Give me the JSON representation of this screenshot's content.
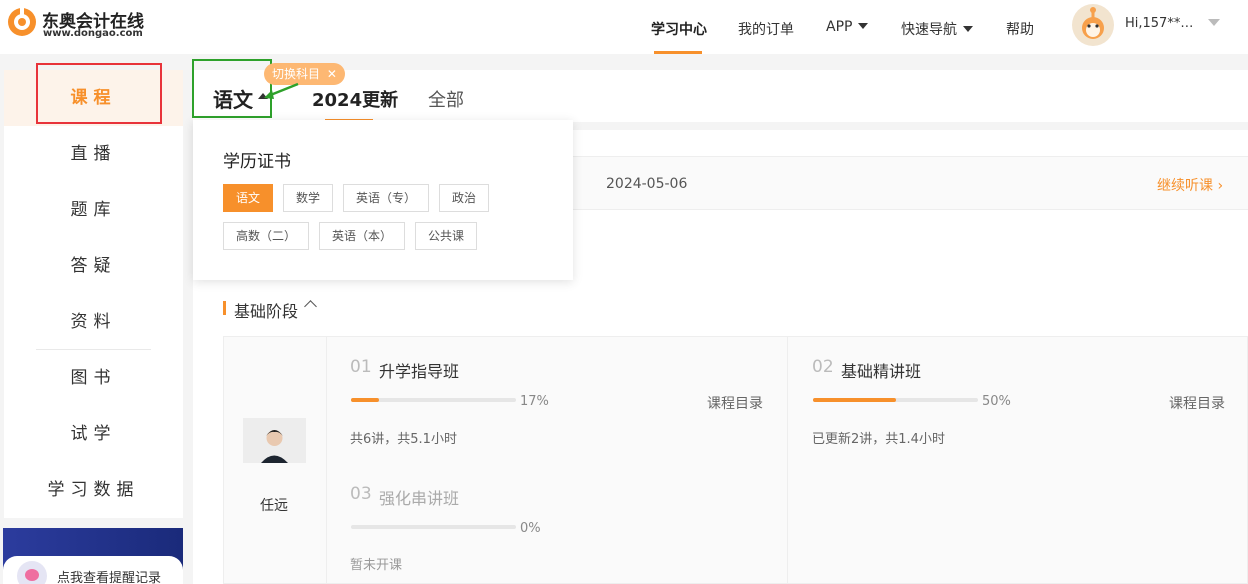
{
  "header": {
    "logo_title": "东奥会计在线",
    "logo_url": "www.dongao.com",
    "nav": [
      {
        "label": "学习中心",
        "active": true
      },
      {
        "label": "我的订单"
      },
      {
        "label": "APP",
        "dropdown": true
      },
      {
        "label": "快速导航",
        "dropdown": true
      },
      {
        "label": "帮助"
      }
    ],
    "user_name": "Hi,157**…"
  },
  "sidebar": {
    "items": [
      {
        "label": "课程",
        "active": true
      },
      {
        "label": "直播"
      },
      {
        "label": "题库"
      },
      {
        "label": "答疑"
      },
      {
        "label": "资料"
      },
      {
        "label": "图书"
      },
      {
        "label": "试学"
      },
      {
        "label": "学习数据"
      }
    ],
    "reminder": "点我查看提醒记录"
  },
  "subject": {
    "current": "语文",
    "switch_tip": "切换科目",
    "tabs": [
      "2024更新",
      "全部"
    ]
  },
  "dropdown": {
    "title": "学历证书",
    "chips": [
      "语文",
      "数学",
      "英语（专）",
      "政治",
      "高数（二）",
      "英语（本）",
      "公共课"
    ],
    "active": "语文"
  },
  "continue": {
    "date": "2024-05-06",
    "link": "继续听课"
  },
  "section": {
    "title": "基础阶段",
    "teacher": "任远",
    "courses": [
      {
        "num": "01",
        "name": "升学指导班",
        "progress": 17,
        "progress_label": "17%",
        "catalog": "课程目录",
        "meta": "共6讲，共5.1小时"
      },
      {
        "num": "02",
        "name": "基础精讲班",
        "progress": 50,
        "progress_label": "50%",
        "catalog": "课程目录",
        "meta": "已更新2讲，共1.4小时"
      },
      {
        "num": "03",
        "name": "强化串讲班",
        "progress": 0,
        "progress_label": "0%",
        "meta": "暂未开课"
      }
    ]
  },
  "colors": {
    "accent": "#f7902b",
    "annotation_red": "#e8333a",
    "annotation_green": "#2ea12b"
  }
}
